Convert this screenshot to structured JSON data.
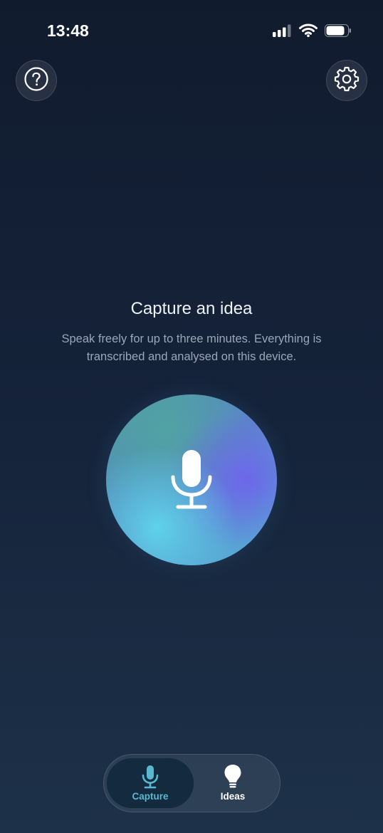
{
  "status_bar": {
    "time": "13:48",
    "icons": [
      "cellular-signal-icon",
      "wifi-icon",
      "battery-icon"
    ]
  },
  "header": {
    "help_icon": "question-mark-circle-icon",
    "settings_icon": "gear-icon"
  },
  "main": {
    "title": "Capture an idea",
    "description": "Speak freely for up to three minutes. Everything is transcribed and analysed on this device.",
    "record_icon": "microphone-icon"
  },
  "tab_bar": {
    "tabs": [
      {
        "label": "Capture",
        "icon": "microphone-icon",
        "active": true
      },
      {
        "label": "Ideas",
        "icon": "lightbulb-icon",
        "active": false
      }
    ]
  },
  "colors": {
    "background_top": "#111b2e",
    "background_bottom": "#1d3148",
    "accent": "#58b8d0",
    "orb_cyan": "#5fd7eb",
    "orb_violet": "#6e64eb"
  }
}
